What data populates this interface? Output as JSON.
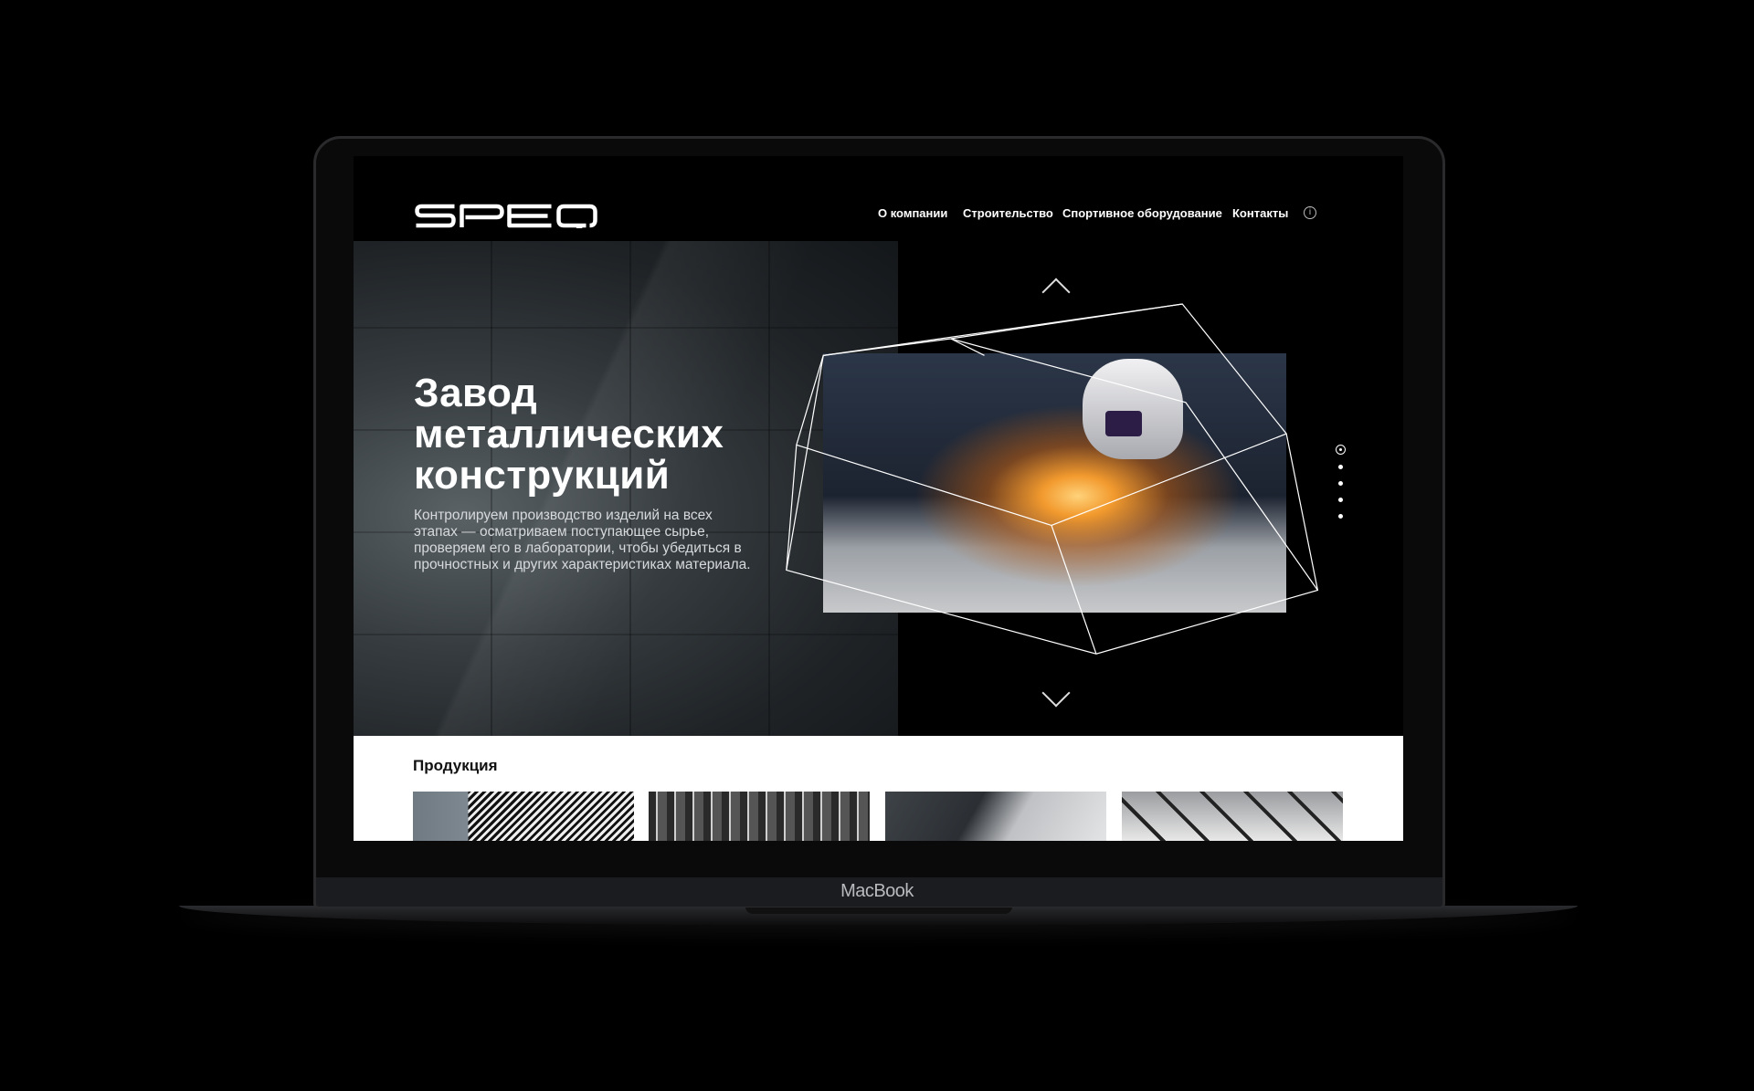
{
  "device": {
    "label": "MacBook"
  },
  "header": {
    "logo": "SPEQ",
    "nav": [
      "О компании",
      "Строительство",
      "Спортивное оборудование",
      "Контакты"
    ],
    "info_icon": "info-icon"
  },
  "hero": {
    "title_lines": [
      "Завод",
      "металлических",
      "конструкций"
    ],
    "description": "Контролируем производство изделий на всех этапах — осматриваем поступающее сырье, проверяем его в лаборатории, чтобы убедиться в прочностных и других характеристиках материала.",
    "slider": {
      "current": 1,
      "total": 5
    }
  },
  "products": {
    "heading": "Продукция",
    "items": [
      "striped-facade",
      "suspended-panels",
      "glass-facade",
      "steel-truss"
    ]
  }
}
